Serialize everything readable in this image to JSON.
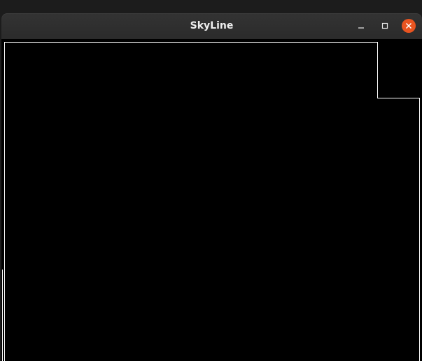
{
  "window": {
    "title": "SkyLine",
    "controls": [
      {
        "name": "minimize",
        "icon": "minimize-icon"
      },
      {
        "name": "maximize",
        "icon": "maximize-icon"
      },
      {
        "name": "close",
        "icon": "close-icon",
        "color": "#e95420"
      }
    ]
  },
  "canvas": {
    "background": "#000000",
    "stroke": "#ffffff"
  }
}
